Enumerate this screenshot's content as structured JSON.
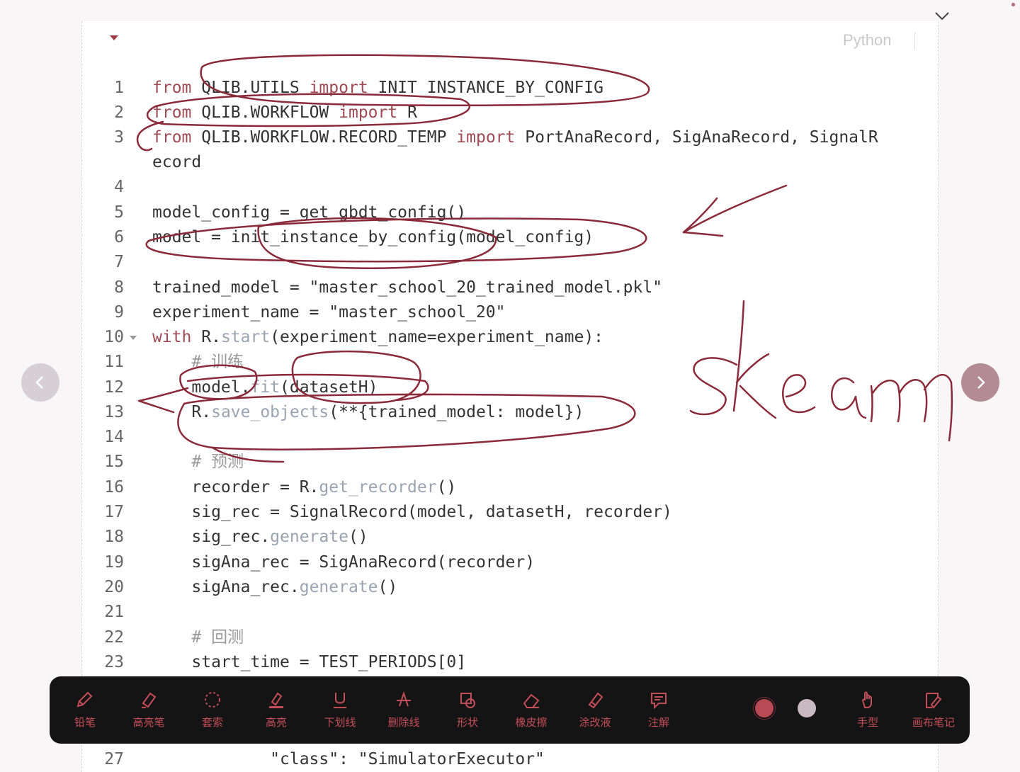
{
  "editor": {
    "language": "Python",
    "lines": [
      {
        "n": "1",
        "segs": [
          [
            "kw",
            "from "
          ],
          [
            "",
            "QLIB.UTILS "
          ],
          [
            "kw",
            "import "
          ],
          [
            "",
            "INIT_INSTANCE_BY_CONFIG"
          ]
        ]
      },
      {
        "n": "2",
        "segs": [
          [
            "kw",
            "from "
          ],
          [
            "",
            "QLIB.WORKFLOW "
          ],
          [
            "kw",
            "import "
          ],
          [
            "",
            "R"
          ]
        ]
      },
      {
        "n": "3",
        "segs": [
          [
            "kw",
            "from "
          ],
          [
            "",
            "QLIB.WORKFLOW.RECORD_TEMP "
          ],
          [
            "kw",
            "import "
          ],
          [
            "",
            "PortAnaRecord, SigAnaRecord, SignalR"
          ]
        ]
      },
      {
        "n": "",
        "segs": [
          [
            "",
            "ecord"
          ]
        ]
      },
      {
        "n": "4",
        "segs": []
      },
      {
        "n": "5",
        "segs": [
          [
            "",
            "model_config = get_gbdt_config()"
          ]
        ]
      },
      {
        "n": "6",
        "segs": [
          [
            "",
            "model = init_instance_by_config(model_config)"
          ]
        ]
      },
      {
        "n": "7",
        "segs": []
      },
      {
        "n": "8",
        "segs": [
          [
            "",
            "trained_model = \"master_school_20_trained_model.pkl\""
          ]
        ]
      },
      {
        "n": "9",
        "segs": [
          [
            "",
            "experiment_name = \"master_school_20\""
          ]
        ]
      },
      {
        "n": "10",
        "fold": true,
        "segs": [
          [
            "kw",
            "with "
          ],
          [
            "",
            "R."
          ],
          [
            "fn",
            "start"
          ],
          [
            "",
            "(experiment_name=experiment_name):"
          ]
        ]
      },
      {
        "n": "11",
        "segs": [
          [
            "cm",
            "    # 训练"
          ]
        ]
      },
      {
        "n": "12",
        "segs": [
          [
            "",
            "    model."
          ],
          [
            "fn",
            "fit"
          ],
          [
            "",
            "(datasetH)"
          ]
        ]
      },
      {
        "n": "13",
        "segs": [
          [
            "",
            "    R."
          ],
          [
            "fn",
            "save_objects"
          ],
          [
            "",
            "(**{trained_model: model})"
          ]
        ]
      },
      {
        "n": "14",
        "segs": []
      },
      {
        "n": "15",
        "segs": [
          [
            "cm",
            "    # 预测"
          ]
        ]
      },
      {
        "n": "16",
        "segs": [
          [
            "",
            "    recorder = R."
          ],
          [
            "fn",
            "get_recorder"
          ],
          [
            "",
            "()"
          ]
        ]
      },
      {
        "n": "17",
        "segs": [
          [
            "",
            "    sig_rec = SignalRecord(model, datasetH, recorder)"
          ]
        ]
      },
      {
        "n": "18",
        "segs": [
          [
            "",
            "    sig_rec."
          ],
          [
            "fn",
            "generate"
          ],
          [
            "",
            "()"
          ]
        ]
      },
      {
        "n": "19",
        "segs": [
          [
            "",
            "    sigAna_rec = SigAnaRecord(recorder)"
          ]
        ]
      },
      {
        "n": "20",
        "segs": [
          [
            "",
            "    sigAna_rec."
          ],
          [
            "fn",
            "generate"
          ],
          [
            "",
            "()"
          ]
        ]
      },
      {
        "n": "21",
        "segs": []
      },
      {
        "n": "22",
        "segs": [
          [
            "cm",
            "    # 回测"
          ]
        ]
      },
      {
        "n": "23",
        "segs": [
          [
            "",
            "    start_time = TEST_PERIODS[0]"
          ]
        ]
      },
      {
        "n": "27",
        "segs": [
          [
            "",
            "            \"class\": \"SimulatorExecutor\""
          ]
        ]
      }
    ]
  },
  "annotation_text": "skearn",
  "ink_color": "#8a2a3a",
  "toolbar": {
    "tools": [
      {
        "name": "pencil-tool",
        "label": "铅笔",
        "icon": "pencil-icon"
      },
      {
        "name": "highlighter-pen-tool",
        "label": "高亮笔",
        "icon": "highlighter-icon"
      },
      {
        "name": "lasso-tool",
        "label": "套索",
        "icon": "lasso-icon"
      },
      {
        "name": "highlight-tool",
        "label": "高亮",
        "icon": "highlight-icon"
      },
      {
        "name": "underline-tool",
        "label": "下划线",
        "icon": "underline-icon"
      },
      {
        "name": "strikethrough-tool",
        "label": "删除线",
        "icon": "strikethrough-icon"
      },
      {
        "name": "shape-tool",
        "label": "形状",
        "icon": "shape-icon"
      },
      {
        "name": "eraser-tool",
        "label": "橡皮擦",
        "icon": "eraser-icon"
      },
      {
        "name": "correction-fluid-tool",
        "label": "涂改液",
        "icon": "correction-fluid-icon"
      },
      {
        "name": "comment-tool",
        "label": "注解",
        "icon": "comment-icon"
      }
    ],
    "colors": [
      "#b94a55",
      "#c9b9c1"
    ],
    "right_tools": [
      {
        "name": "hand-tool",
        "label": "手型",
        "icon": "hand-icon"
      },
      {
        "name": "canvas-notes-tool",
        "label": "画布笔记",
        "icon": "canvas-notes-icon"
      }
    ],
    "accent": "#c44d5a"
  }
}
